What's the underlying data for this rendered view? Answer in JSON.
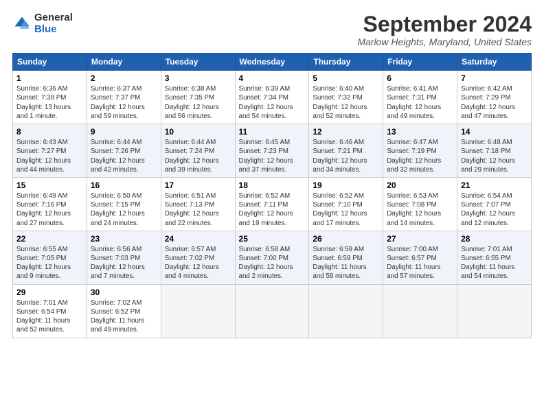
{
  "logo": {
    "general": "General",
    "blue": "Blue"
  },
  "title": "September 2024",
  "location": "Marlow Heights, Maryland, United States",
  "days_of_week": [
    "Sunday",
    "Monday",
    "Tuesday",
    "Wednesday",
    "Thursday",
    "Friday",
    "Saturday"
  ],
  "weeks": [
    [
      {
        "day": "1",
        "info": "Sunrise: 6:36 AM\nSunset: 7:38 PM\nDaylight: 13 hours\nand 1 minute."
      },
      {
        "day": "2",
        "info": "Sunrise: 6:37 AM\nSunset: 7:37 PM\nDaylight: 12 hours\nand 59 minutes."
      },
      {
        "day": "3",
        "info": "Sunrise: 6:38 AM\nSunset: 7:35 PM\nDaylight: 12 hours\nand 56 minutes."
      },
      {
        "day": "4",
        "info": "Sunrise: 6:39 AM\nSunset: 7:34 PM\nDaylight: 12 hours\nand 54 minutes."
      },
      {
        "day": "5",
        "info": "Sunrise: 6:40 AM\nSunset: 7:32 PM\nDaylight: 12 hours\nand 52 minutes."
      },
      {
        "day": "6",
        "info": "Sunrise: 6:41 AM\nSunset: 7:31 PM\nDaylight: 12 hours\nand 49 minutes."
      },
      {
        "day": "7",
        "info": "Sunrise: 6:42 AM\nSunset: 7:29 PM\nDaylight: 12 hours\nand 47 minutes."
      }
    ],
    [
      {
        "day": "8",
        "info": "Sunrise: 6:43 AM\nSunset: 7:27 PM\nDaylight: 12 hours\nand 44 minutes."
      },
      {
        "day": "9",
        "info": "Sunrise: 6:44 AM\nSunset: 7:26 PM\nDaylight: 12 hours\nand 42 minutes."
      },
      {
        "day": "10",
        "info": "Sunrise: 6:44 AM\nSunset: 7:24 PM\nDaylight: 12 hours\nand 39 minutes."
      },
      {
        "day": "11",
        "info": "Sunrise: 6:45 AM\nSunset: 7:23 PM\nDaylight: 12 hours\nand 37 minutes."
      },
      {
        "day": "12",
        "info": "Sunrise: 6:46 AM\nSunset: 7:21 PM\nDaylight: 12 hours\nand 34 minutes."
      },
      {
        "day": "13",
        "info": "Sunrise: 6:47 AM\nSunset: 7:19 PM\nDaylight: 12 hours\nand 32 minutes."
      },
      {
        "day": "14",
        "info": "Sunrise: 6:48 AM\nSunset: 7:18 PM\nDaylight: 12 hours\nand 29 minutes."
      }
    ],
    [
      {
        "day": "15",
        "info": "Sunrise: 6:49 AM\nSunset: 7:16 PM\nDaylight: 12 hours\nand 27 minutes."
      },
      {
        "day": "16",
        "info": "Sunrise: 6:50 AM\nSunset: 7:15 PM\nDaylight: 12 hours\nand 24 minutes."
      },
      {
        "day": "17",
        "info": "Sunrise: 6:51 AM\nSunset: 7:13 PM\nDaylight: 12 hours\nand 22 minutes."
      },
      {
        "day": "18",
        "info": "Sunrise: 6:52 AM\nSunset: 7:11 PM\nDaylight: 12 hours\nand 19 minutes."
      },
      {
        "day": "19",
        "info": "Sunrise: 6:52 AM\nSunset: 7:10 PM\nDaylight: 12 hours\nand 17 minutes."
      },
      {
        "day": "20",
        "info": "Sunrise: 6:53 AM\nSunset: 7:08 PM\nDaylight: 12 hours\nand 14 minutes."
      },
      {
        "day": "21",
        "info": "Sunrise: 6:54 AM\nSunset: 7:07 PM\nDaylight: 12 hours\nand 12 minutes."
      }
    ],
    [
      {
        "day": "22",
        "info": "Sunrise: 6:55 AM\nSunset: 7:05 PM\nDaylight: 12 hours\nand 9 minutes."
      },
      {
        "day": "23",
        "info": "Sunrise: 6:56 AM\nSunset: 7:03 PM\nDaylight: 12 hours\nand 7 minutes."
      },
      {
        "day": "24",
        "info": "Sunrise: 6:57 AM\nSunset: 7:02 PM\nDaylight: 12 hours\nand 4 minutes."
      },
      {
        "day": "25",
        "info": "Sunrise: 6:58 AM\nSunset: 7:00 PM\nDaylight: 12 hours\nand 2 minutes."
      },
      {
        "day": "26",
        "info": "Sunrise: 6:59 AM\nSunset: 6:59 PM\nDaylight: 11 hours\nand 59 minutes."
      },
      {
        "day": "27",
        "info": "Sunrise: 7:00 AM\nSunset: 6:57 PM\nDaylight: 11 hours\nand 57 minutes."
      },
      {
        "day": "28",
        "info": "Sunrise: 7:01 AM\nSunset: 6:55 PM\nDaylight: 11 hours\nand 54 minutes."
      }
    ],
    [
      {
        "day": "29",
        "info": "Sunrise: 7:01 AM\nSunset: 6:54 PM\nDaylight: 11 hours\nand 52 minutes."
      },
      {
        "day": "30",
        "info": "Sunrise: 7:02 AM\nSunset: 6:52 PM\nDaylight: 11 hours\nand 49 minutes."
      },
      null,
      null,
      null,
      null,
      null
    ]
  ]
}
